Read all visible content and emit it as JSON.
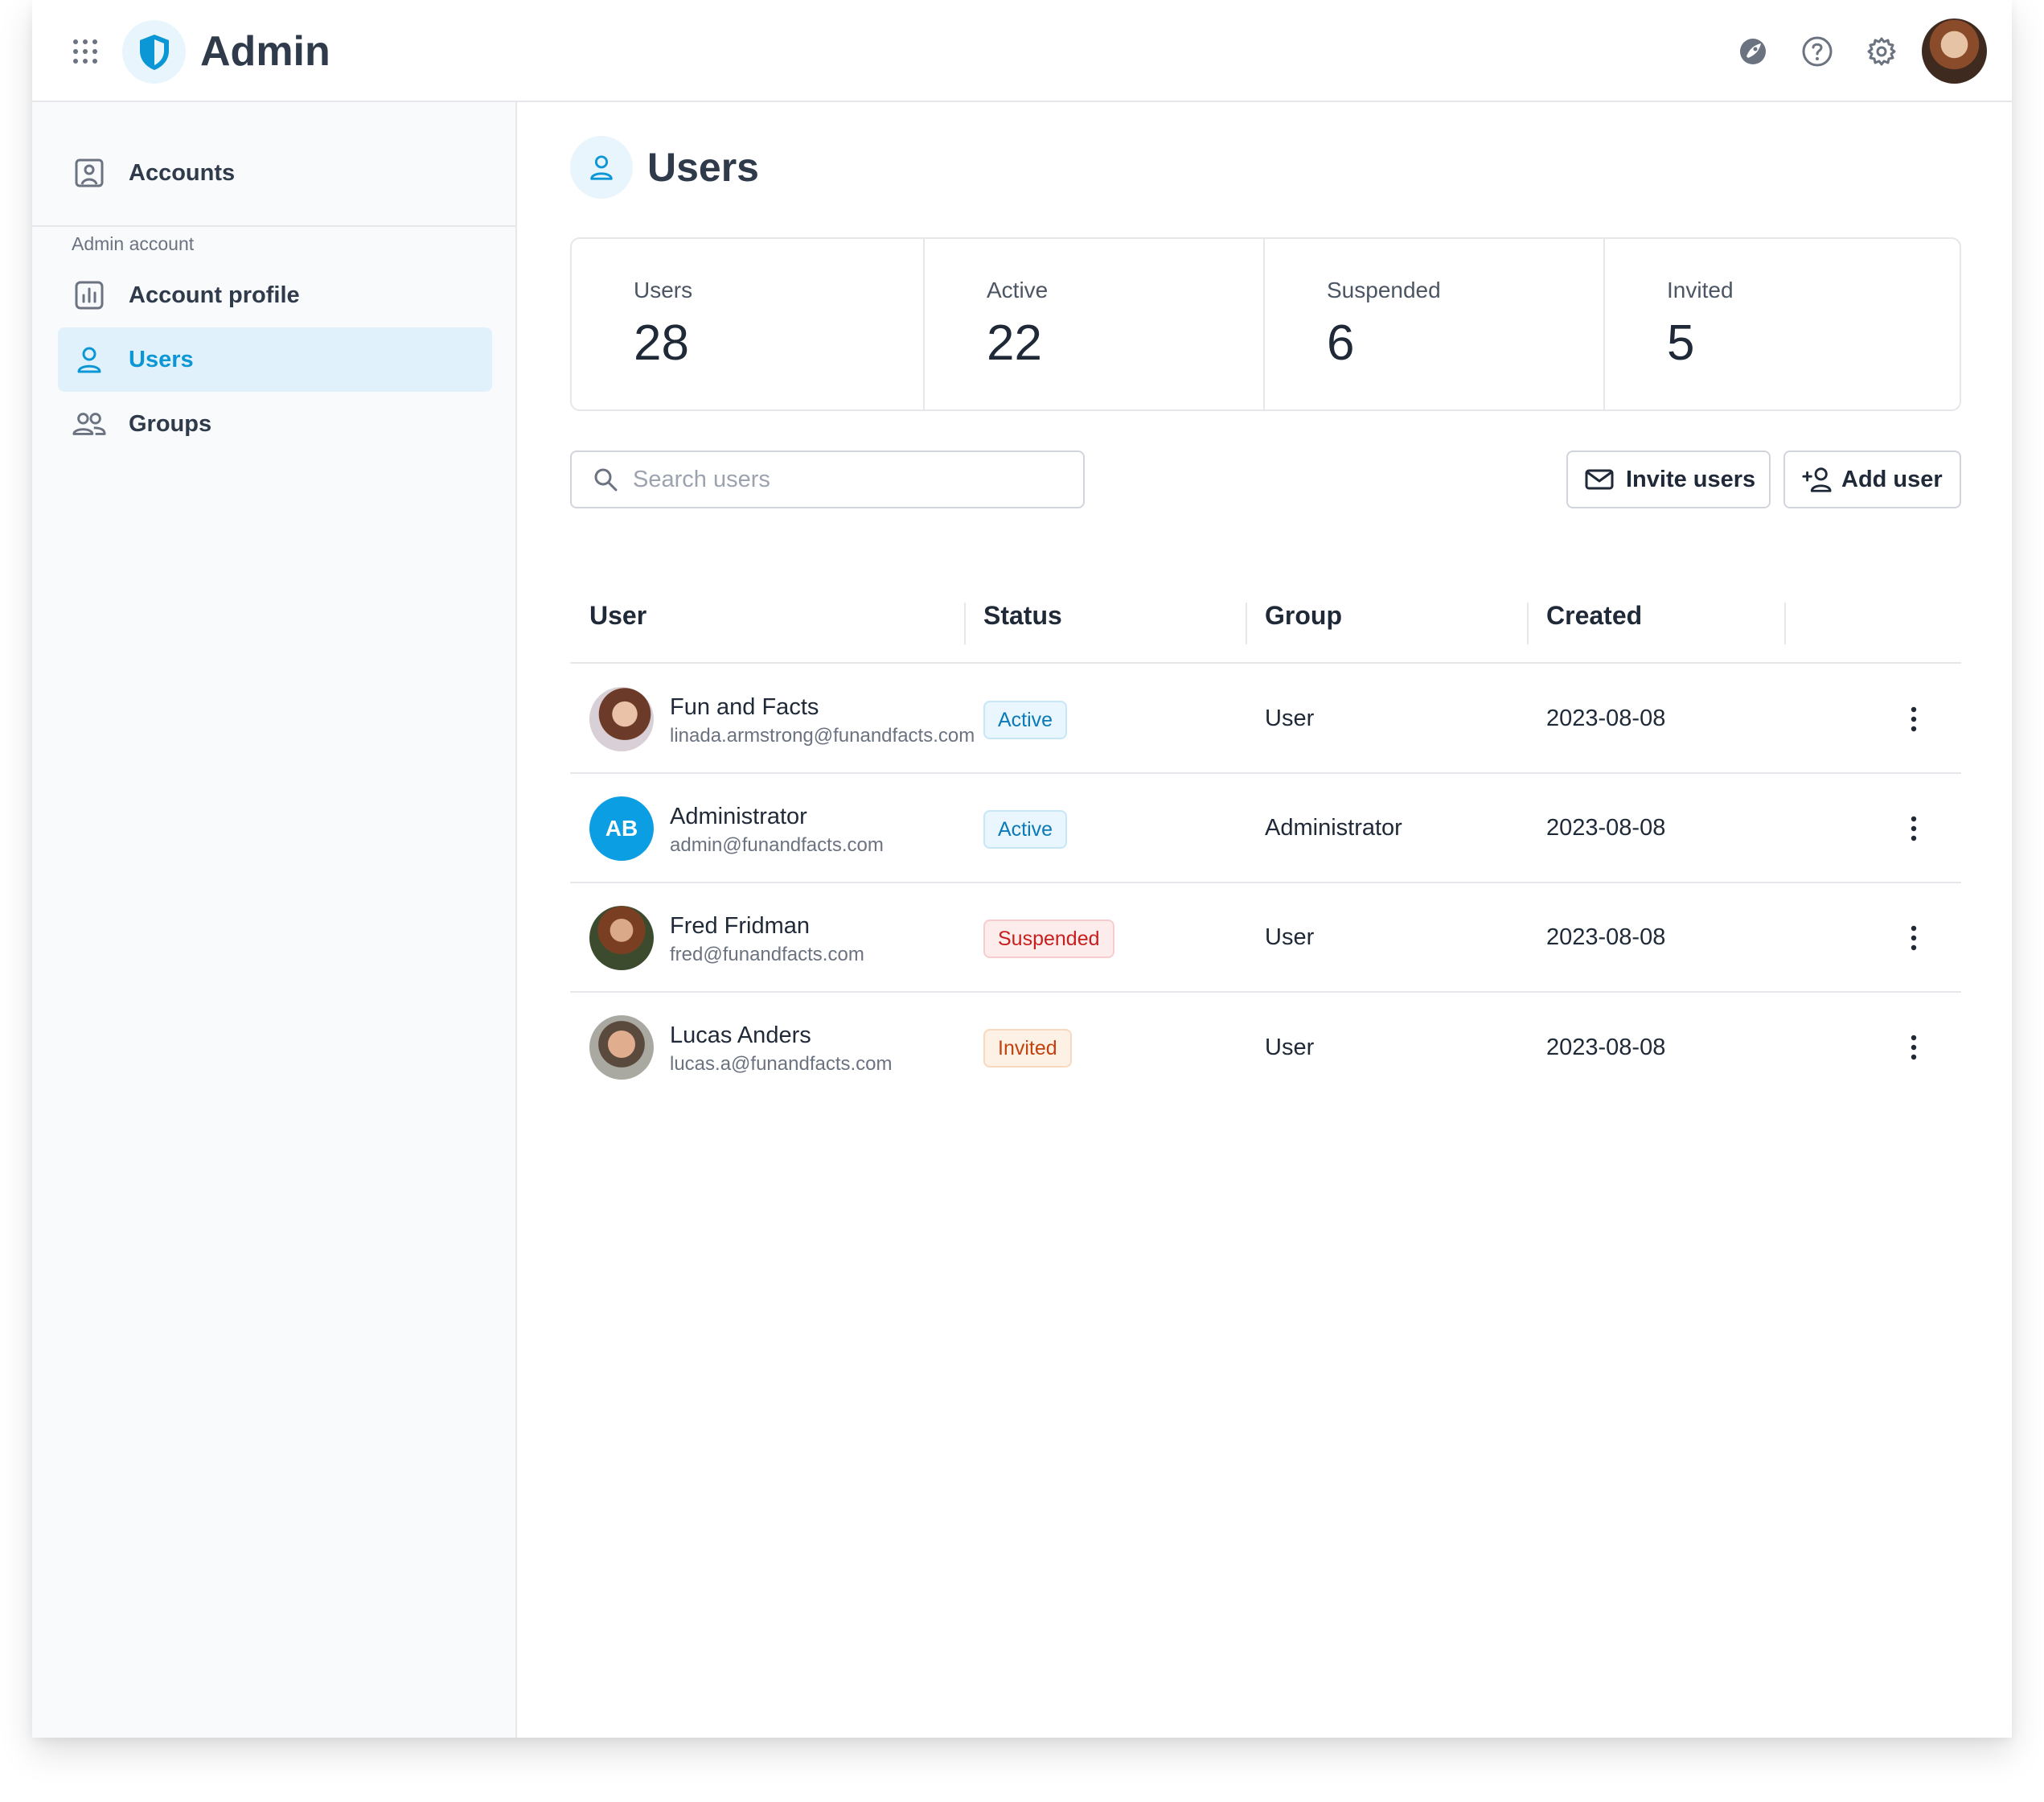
{
  "app": {
    "title": "Admin"
  },
  "topbar": {
    "icons": [
      "apps-grid-icon",
      "shield-logo-icon",
      "rocket-icon",
      "help-circle-icon",
      "settings-gear-icon"
    ],
    "profile_avatar": "user-avatar"
  },
  "sidebar": {
    "top_item": {
      "label": "Accounts",
      "icon": "account-portrait-icon"
    },
    "section_label": "Admin account",
    "items": [
      {
        "label": "Account profile",
        "icon": "bar-chart-icon",
        "active": false
      },
      {
        "label": "Users",
        "icon": "user-icon",
        "active": true
      },
      {
        "label": "Groups",
        "icon": "users-group-icon",
        "active": false
      }
    ]
  },
  "page": {
    "title": "Users",
    "icon": "user-icon"
  },
  "stats": [
    {
      "label": "Users",
      "value": "28"
    },
    {
      "label": "Active",
      "value": "22"
    },
    {
      "label": "Suspended",
      "value": "6"
    },
    {
      "label": "Invited",
      "value": "5"
    }
  ],
  "search": {
    "placeholder": "Search users",
    "value": ""
  },
  "actions": {
    "invite_label": "Invite users",
    "add_label": "Add user"
  },
  "table": {
    "columns": [
      "User",
      "Status",
      "Group",
      "Created"
    ],
    "rows": [
      {
        "name": "Fun and Facts",
        "email": "linada.armstrong@funandfacts.com",
        "avatar": "photo",
        "initials": "",
        "status": "Active",
        "status_kind": "active",
        "group": "User",
        "created": "2023-08-08"
      },
      {
        "name": "Administrator",
        "email": "admin@funandfacts.com",
        "avatar": "initials",
        "initials": "AB",
        "status": "Active",
        "status_kind": "active",
        "group": "Administrator",
        "created": "2023-08-08"
      },
      {
        "name": "Fred Fridman",
        "email": "fred@funandfacts.com",
        "avatar": "photo",
        "initials": "",
        "status": "Suspended",
        "status_kind": "suspended",
        "group": "User",
        "created": "2023-08-08"
      },
      {
        "name": "Lucas Anders",
        "email": "lucas.a@funandfacts.com",
        "avatar": "photo",
        "initials": "",
        "status": "Invited",
        "status_kind": "invited",
        "group": "User",
        "created": "2023-08-08"
      }
    ]
  },
  "colors": {
    "accent": "#0b97d6",
    "active_badge": "#0b7ab8",
    "suspended_badge": "#c81e1e",
    "invited_badge": "#c2410c"
  }
}
